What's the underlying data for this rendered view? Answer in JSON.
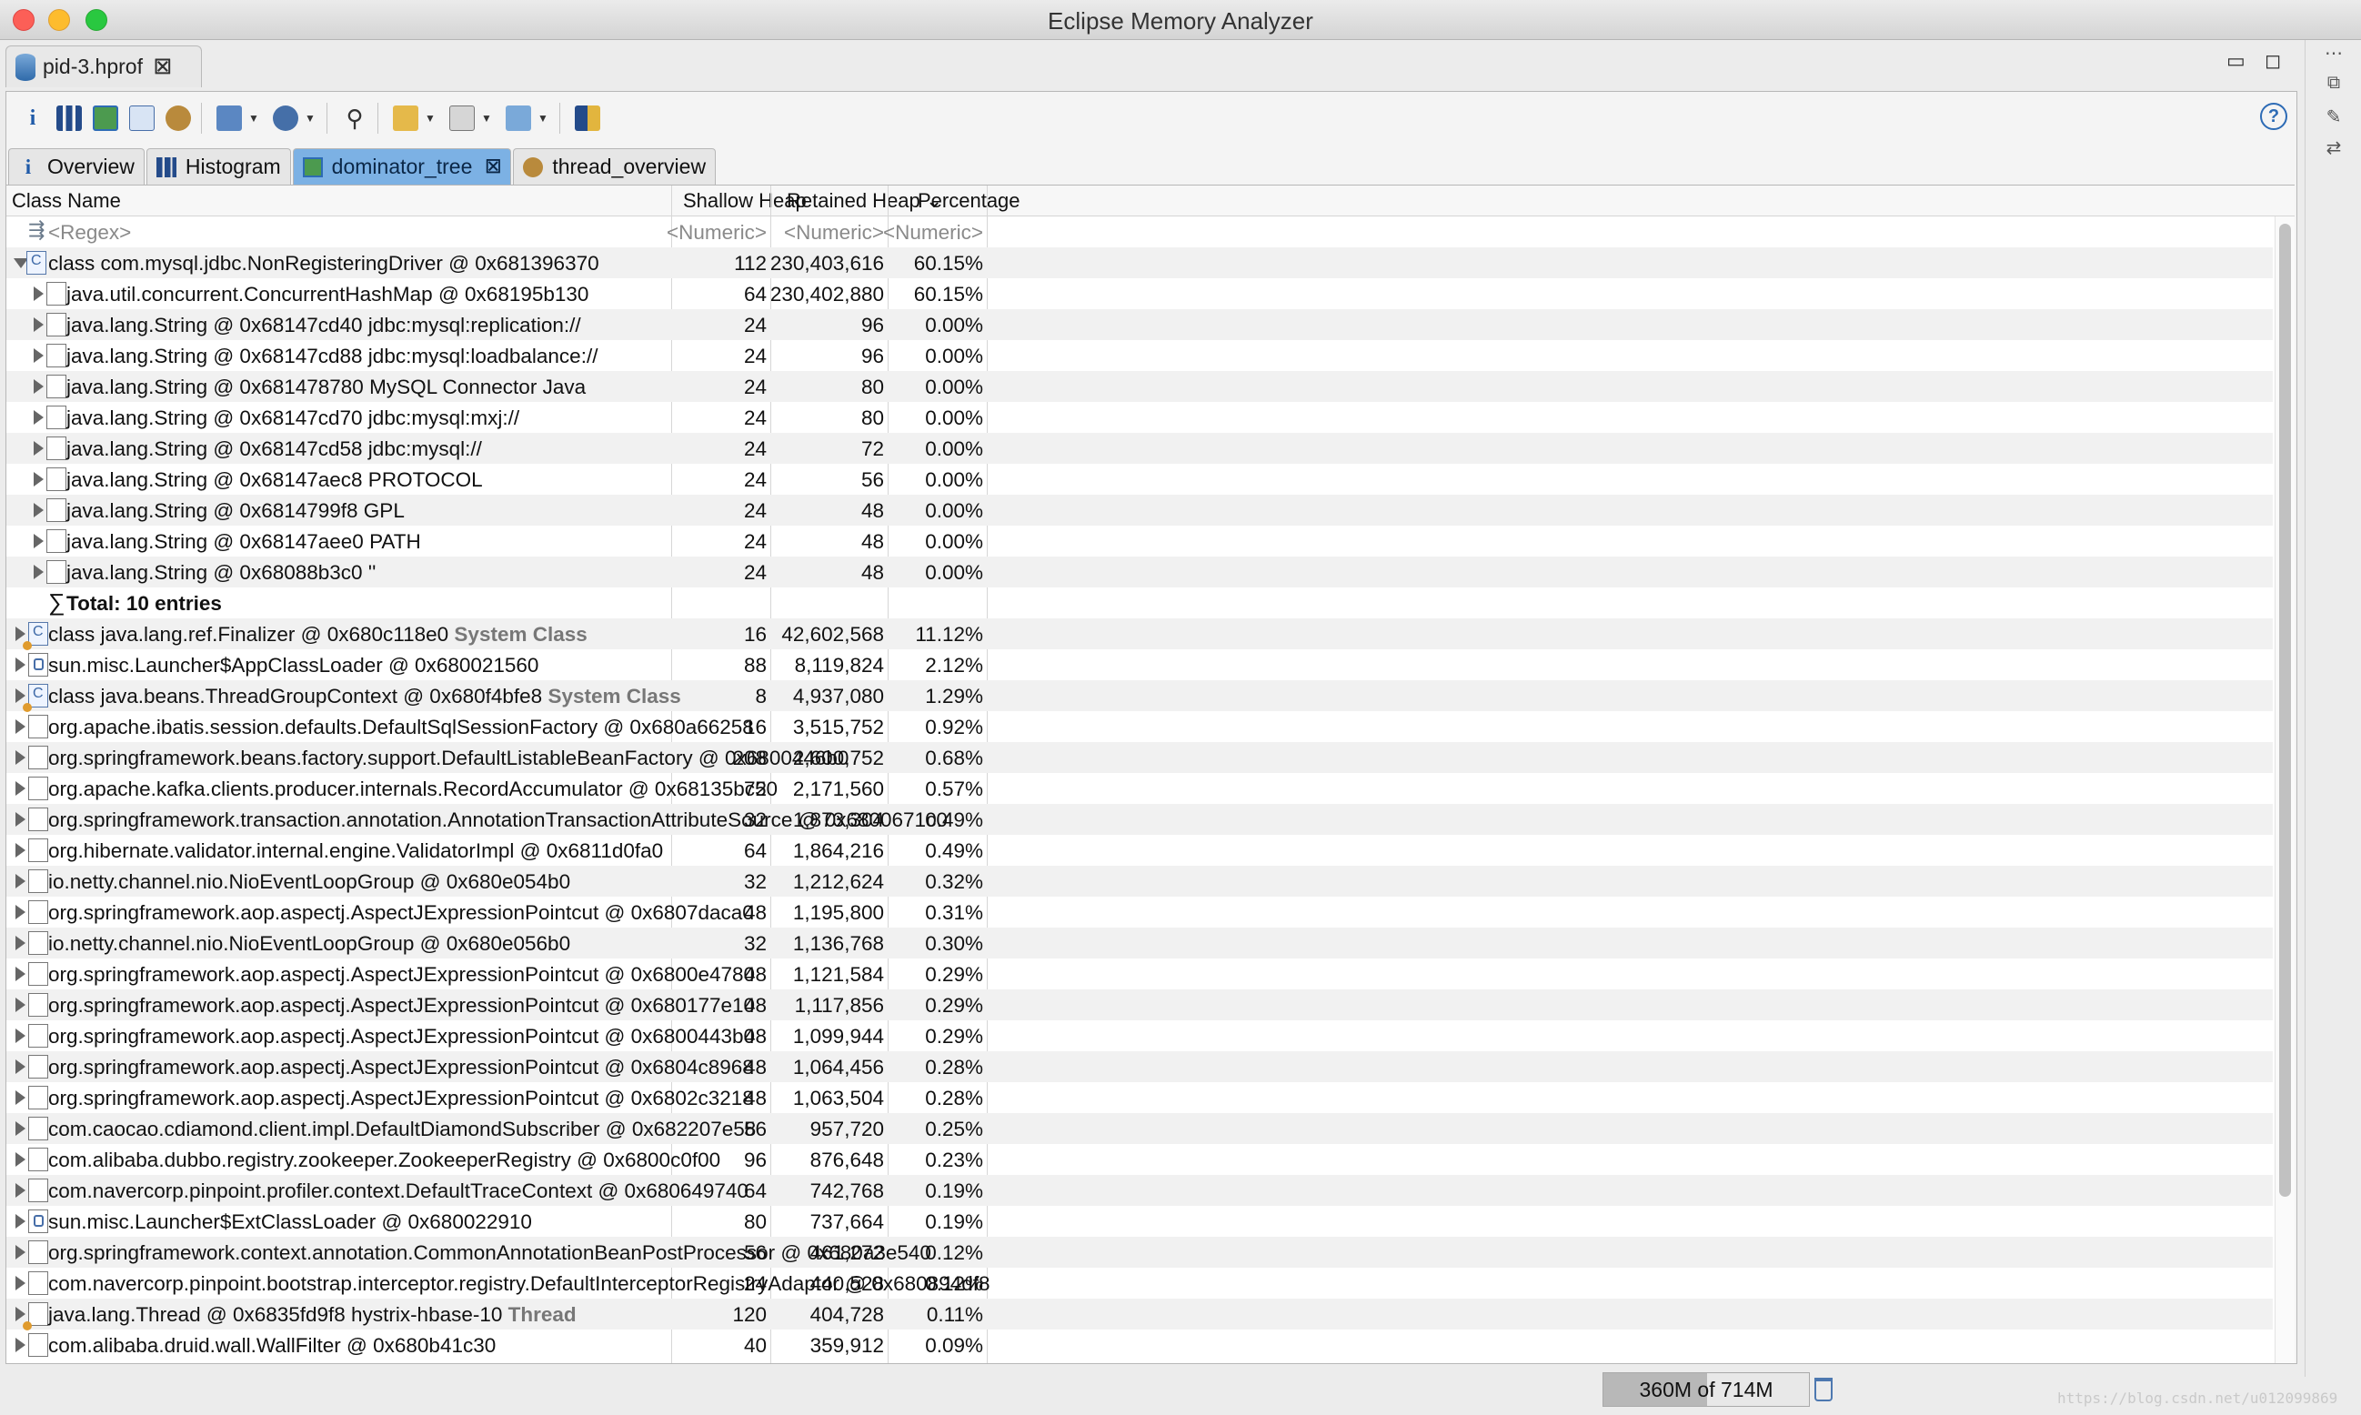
{
  "window": {
    "title": "Eclipse Memory Analyzer"
  },
  "editor_tab": {
    "label": "pid-3.hprof",
    "close": "☒"
  },
  "tabs": [
    {
      "label": "Overview",
      "icon": "info-icon"
    },
    {
      "label": "Histogram",
      "icon": "histogram-icon"
    },
    {
      "label": "dominator_tree",
      "icon": "dominator-tree-icon",
      "close": "☒",
      "active": true
    },
    {
      "label": "thread_overview",
      "icon": "thread-gear-icon"
    }
  ],
  "columns": {
    "class_name": "Class Name",
    "shallow": "Shallow Heap",
    "retained": "Retained Heap",
    "sort_indicator": "⌄",
    "percentage": "Percentage"
  },
  "filter": {
    "regex": "<Regex>",
    "numeric": "<Numeric>"
  },
  "expanded_root": {
    "name": "class com.mysql.jdbc.NonRegisteringDriver @ 0x681396370",
    "shallow": "112",
    "retained": "230,403,616",
    "pct": "60.15%"
  },
  "children": [
    {
      "name": "java.util.concurrent.ConcurrentHashMap @ 0x68195b130",
      "shallow": "64",
      "retained": "230,402,880",
      "pct": "60.15%"
    },
    {
      "name": "java.lang.String @ 0x68147cd40  jdbc:mysql:replication://",
      "shallow": "24",
      "retained": "96",
      "pct": "0.00%"
    },
    {
      "name": "java.lang.String @ 0x68147cd88  jdbc:mysql:loadbalance://",
      "shallow": "24",
      "retained": "96",
      "pct": "0.00%"
    },
    {
      "name": "java.lang.String @ 0x681478780  MySQL Connector Java",
      "shallow": "24",
      "retained": "80",
      "pct": "0.00%"
    },
    {
      "name": "java.lang.String @ 0x68147cd70  jdbc:mysql:mxj://",
      "shallow": "24",
      "retained": "80",
      "pct": "0.00%"
    },
    {
      "name": "java.lang.String @ 0x68147cd58  jdbc:mysql://",
      "shallow": "24",
      "retained": "72",
      "pct": "0.00%"
    },
    {
      "name": "java.lang.String @ 0x68147aec8  PROTOCOL",
      "shallow": "24",
      "retained": "56",
      "pct": "0.00%"
    },
    {
      "name": "java.lang.String @ 0x6814799f8  GPL",
      "shallow": "24",
      "retained": "48",
      "pct": "0.00%"
    },
    {
      "name": "java.lang.String @ 0x68147aee0  PATH",
      "shallow": "24",
      "retained": "48",
      "pct": "0.00%"
    },
    {
      "name": "java.lang.String @ 0x68088b3c0  ''",
      "shallow": "24",
      "retained": "48",
      "pct": "0.00%"
    }
  ],
  "total": {
    "sigma": "∑",
    "label": "Total: 10 entries"
  },
  "rows": [
    {
      "name": "class java.lang.ref.Finalizer @ 0x680c118e0",
      "tag": "System Class",
      "icon": "class-system",
      "shallow": "16",
      "retained": "42,602,568",
      "pct": "11.12%"
    },
    {
      "name": "sun.misc.Launcher$AppClassLoader @ 0x680021560",
      "tag": "",
      "icon": "classloader",
      "shallow": "88",
      "retained": "8,119,824",
      "pct": "2.12%"
    },
    {
      "name": "class java.beans.ThreadGroupContext @ 0x680f4bfe8",
      "tag": "System Class",
      "icon": "class-system",
      "shallow": "8",
      "retained": "4,937,080",
      "pct": "1.29%"
    },
    {
      "name": "org.apache.ibatis.session.defaults.DefaultSqlSessionFactory @ 0x680a66258",
      "tag": "",
      "icon": "object",
      "shallow": "16",
      "retained": "3,515,752",
      "pct": "0.92%"
    },
    {
      "name": "org.springframework.beans.factory.support.DefaultListableBeanFactory @ 0x6800446b0",
      "tag": "",
      "icon": "object",
      "shallow": "208",
      "retained": "2,600,752",
      "pct": "0.68%"
    },
    {
      "name": "org.apache.kafka.clients.producer.internals.RecordAccumulator @ 0x68135bc50",
      "tag": "",
      "icon": "object",
      "shallow": "72",
      "retained": "2,171,560",
      "pct": "0.57%"
    },
    {
      "name": "org.springframework.transaction.annotation.AnnotationTransactionAttributeSource @ 0x6800671c0",
      "tag": "",
      "icon": "object",
      "shallow": "32",
      "retained": "1,873,304",
      "pct": "0.49%"
    },
    {
      "name": "org.hibernate.validator.internal.engine.ValidatorImpl @ 0x6811d0fa0",
      "tag": "",
      "icon": "object",
      "shallow": "64",
      "retained": "1,864,216",
      "pct": "0.49%"
    },
    {
      "name": "io.netty.channel.nio.NioEventLoopGroup @ 0x680e054b0",
      "tag": "",
      "icon": "object",
      "shallow": "32",
      "retained": "1,212,624",
      "pct": "0.32%"
    },
    {
      "name": "org.springframework.aop.aspectj.AspectJExpressionPointcut @ 0x6807daca0",
      "tag": "",
      "icon": "object",
      "shallow": "48",
      "retained": "1,195,800",
      "pct": "0.31%"
    },
    {
      "name": "io.netty.channel.nio.NioEventLoopGroup @ 0x680e056b0",
      "tag": "",
      "icon": "object",
      "shallow": "32",
      "retained": "1,136,768",
      "pct": "0.30%"
    },
    {
      "name": "org.springframework.aop.aspectj.AspectJExpressionPointcut @ 0x6800e4780",
      "tag": "",
      "icon": "object",
      "shallow": "48",
      "retained": "1,121,584",
      "pct": "0.29%"
    },
    {
      "name": "org.springframework.aop.aspectj.AspectJExpressionPointcut @ 0x680177e10",
      "tag": "",
      "icon": "object",
      "shallow": "48",
      "retained": "1,117,856",
      "pct": "0.29%"
    },
    {
      "name": "org.springframework.aop.aspectj.AspectJExpressionPointcut @ 0x6800443b0",
      "tag": "",
      "icon": "object",
      "shallow": "48",
      "retained": "1,099,944",
      "pct": "0.29%"
    },
    {
      "name": "org.springframework.aop.aspectj.AspectJExpressionPointcut @ 0x6804c8968",
      "tag": "",
      "icon": "object",
      "shallow": "48",
      "retained": "1,064,456",
      "pct": "0.28%"
    },
    {
      "name": "org.springframework.aop.aspectj.AspectJExpressionPointcut @ 0x6802c3218",
      "tag": "",
      "icon": "object",
      "shallow": "48",
      "retained": "1,063,504",
      "pct": "0.28%"
    },
    {
      "name": "com.caocao.cdiamond.client.impl.DefaultDiamondSubscriber @ 0x682207e58",
      "tag": "",
      "icon": "object",
      "shallow": "56",
      "retained": "957,720",
      "pct": "0.25%"
    },
    {
      "name": "com.alibaba.dubbo.registry.zookeeper.ZookeeperRegistry @ 0x6800c0f00",
      "tag": "",
      "icon": "object",
      "shallow": "96",
      "retained": "876,648",
      "pct": "0.23%"
    },
    {
      "name": "com.navercorp.pinpoint.profiler.context.DefaultTraceContext @ 0x680649740",
      "tag": "",
      "icon": "object",
      "shallow": "64",
      "retained": "742,768",
      "pct": "0.19%"
    },
    {
      "name": "sun.misc.Launcher$ExtClassLoader @ 0x680022910",
      "tag": "",
      "icon": "classloader",
      "shallow": "80",
      "retained": "737,664",
      "pct": "0.19%"
    },
    {
      "name": "org.springframework.context.annotation.CommonAnnotationBeanPostProcessor @ 0x680a3e540",
      "tag": "",
      "icon": "object",
      "shallow": "56",
      "retained": "461,272",
      "pct": "0.12%"
    },
    {
      "name": "com.navercorp.pinpoint.bootstrap.interceptor.registry.DefaultInterceptorRegistryAdaptor @ 0x680894df8",
      "tag": "",
      "icon": "object",
      "shallow": "24",
      "retained": "440,528",
      "pct": "0.12%"
    },
    {
      "name": "java.lang.Thread @ 0x6835fd9f8  hystrix-hbase-10",
      "tag": "Thread",
      "icon": "thread",
      "shallow": "120",
      "retained": "404,728",
      "pct": "0.11%"
    },
    {
      "name": "com.alibaba.druid.wall.WallFilter @ 0x680b41c30",
      "tag": "",
      "icon": "object",
      "shallow": "40",
      "retained": "359,912",
      "pct": "0.09%"
    }
  ],
  "status": {
    "heap": "360M of 714M",
    "heap_used_fraction": 0.504
  },
  "watermark": "https://blog.csdn.net/u012099869",
  "help": "?"
}
